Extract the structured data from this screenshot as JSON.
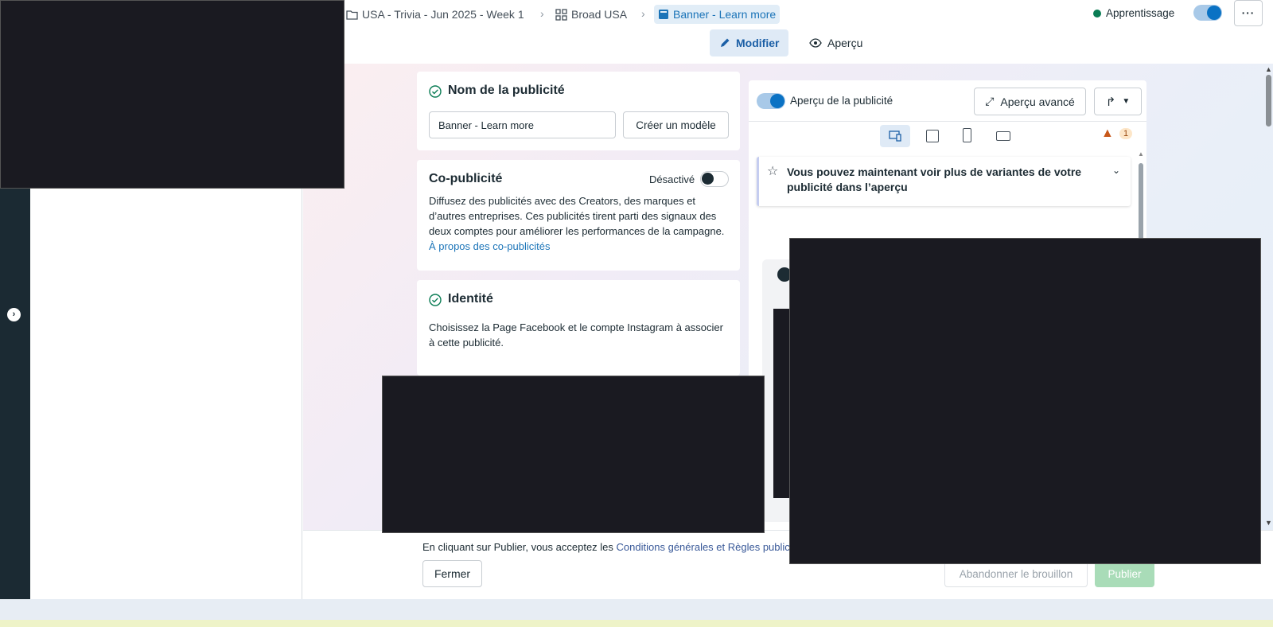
{
  "breadcrumb": {
    "campaign": "USA - Trivia - Jun 2025 - Week 1",
    "adset": "Broad USA",
    "ad": "Banner - Learn more"
  },
  "header": {
    "status_label": "Apprentissage",
    "status_color": "#0a7c54",
    "more_label": "···"
  },
  "tabs": {
    "edit": "Modifier",
    "preview": "Aperçu"
  },
  "ad_name": {
    "title": "Nom de la publicité",
    "value": "Banner - Learn more",
    "create_template": "Créer un modèle"
  },
  "copub": {
    "title": "Co-publicité",
    "status": "Désactivé",
    "description": "Diffusez des publicités avec des Creators, des marques et d’autres entreprises. Ces publicités tirent parti des signaux des deux comptes pour améliorer les performances de la campagne.",
    "link": "À propos des co-publicités"
  },
  "identity": {
    "title": "Identité",
    "description": "Choisissez la Page Facebook et le compte Instagram à associer à cette publicité."
  },
  "preview_panel": {
    "toggle_label": "Aperçu de la publicité",
    "advanced_label": "Aperçu avancé",
    "warning_count": "1",
    "notice": "Vous pouvez maintenant voir plus de variantes de votre publicité dans l’aperçu"
  },
  "footer": {
    "terms_prefix": "En cliquant sur Publier, vous acceptez les",
    "terms_link": "Conditions générales et Règles public",
    "close": "Fermer",
    "discard": "Abandonner le brouillon",
    "publish": "Publier"
  },
  "colors": {
    "accent": "#1b74b8",
    "publish_disabled": "#a9dcb8"
  }
}
